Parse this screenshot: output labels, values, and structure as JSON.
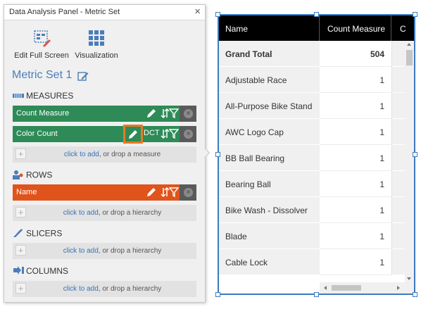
{
  "panel": {
    "title": "Data Analysis Panel - Metric Set",
    "close": "×",
    "tools": [
      {
        "label": "Edit Full Screen",
        "icon": "edit-full-screen-icon"
      },
      {
        "label": "Visualization",
        "icon": "visualization-grid-icon"
      }
    ],
    "metric_set_title": "Metric Set 1",
    "sections": {
      "measures": "MEASURES",
      "rows": "ROWS",
      "slicers": "SLICERS",
      "columns": "COLUMNS"
    },
    "measures": [
      {
        "name": "Count Measure"
      },
      {
        "name": "Color Count",
        "suffix": "DCT"
      }
    ],
    "rows": [
      {
        "name": "Name"
      }
    ],
    "drop": {
      "link": "click to add",
      "measure_text": ", or drop a measure",
      "hierarchy_text": ", or drop a hierarchy"
    },
    "colors": {
      "measure": "#2e8b57",
      "row": "#e0541c",
      "link": "#3a72b8",
      "highlight": "#e87a22"
    }
  },
  "grid": {
    "headers": [
      "Name",
      "Count Measure",
      "C"
    ],
    "total": {
      "name": "Grand Total",
      "value": "504"
    },
    "rows": [
      {
        "name": "Adjustable Race",
        "value": "1"
      },
      {
        "name": "All-Purpose Bike Stand",
        "value": "1"
      },
      {
        "name": "AWC Logo Cap",
        "value": "1"
      },
      {
        "name": "BB Ball Bearing",
        "value": "1"
      },
      {
        "name": "Bearing Ball",
        "value": "1"
      },
      {
        "name": "Bike Wash - Dissolver",
        "value": "1"
      },
      {
        "name": "Blade",
        "value": "1"
      },
      {
        "name": "Cable Lock",
        "value": "1"
      }
    ],
    "accent": "#3b7ac0"
  }
}
